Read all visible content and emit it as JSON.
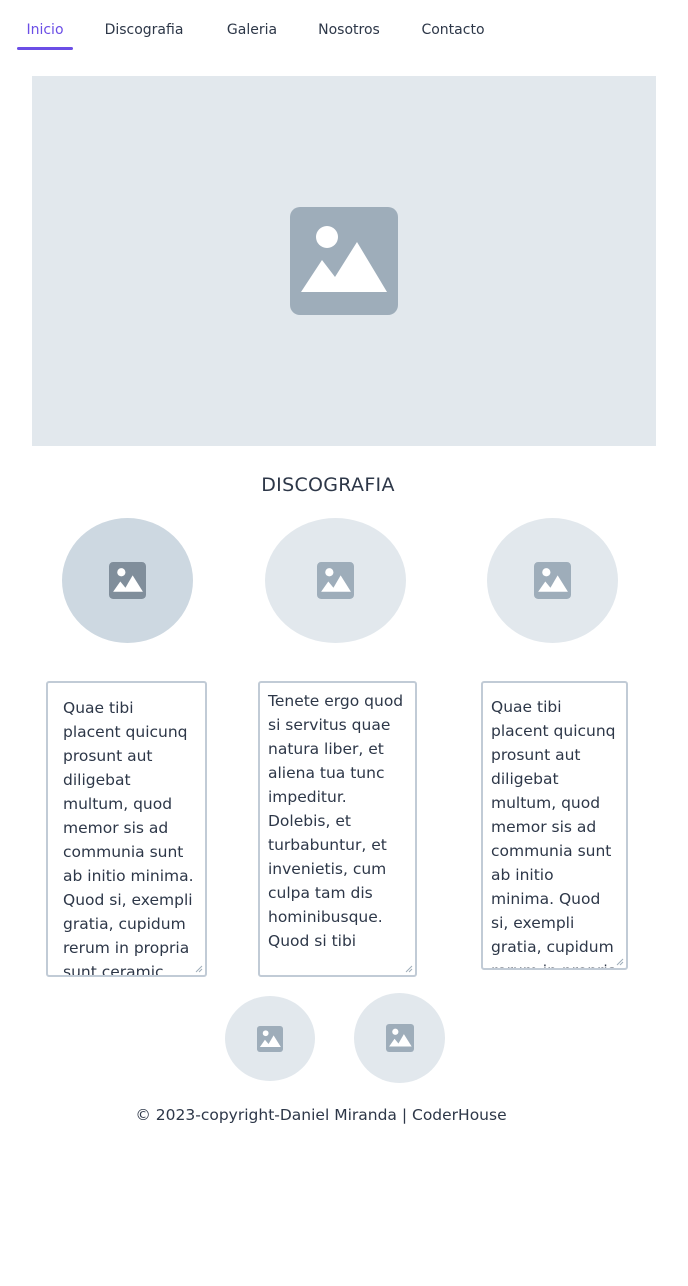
{
  "nav": {
    "items": [
      {
        "label": "Inicio",
        "active": true
      },
      {
        "label": "Discografia",
        "active": false
      },
      {
        "label": "Galeria",
        "active": false
      },
      {
        "label": "Nosotros",
        "active": false
      },
      {
        "label": "Contacto",
        "active": false
      }
    ],
    "accent_color": "#6b4ee6"
  },
  "hero": {
    "icon": "image-icon",
    "background": "#e2e8ed"
  },
  "discografia": {
    "title": "DISCOGRAFIA",
    "albums": [
      {
        "icon": "image-icon",
        "selected": true
      },
      {
        "icon": "image-icon",
        "selected": false
      },
      {
        "icon": "image-icon",
        "selected": false
      }
    ],
    "texts": [
      "Quae tibi placent quicunq prosunt aut diligebat multum, quod memor sis ad communia sunt ab initio minima. Quod si, exempli gratia, cupidum rerum in propria sunt ceramic",
      "Tenete ergo quod si servitus quae natura liber, et aliena tua tunc impeditur. Dolebis, et turbabuntur, et invenietis, cum culpa tam dis hominibusque. Quod si tibi",
      "Quae tibi placent quicunq prosunt aut diligebat multum, quod memor sis ad communia sunt ab initio minima. Quod si, exempli gratia, cupidum rerum in propria sunt ceramic"
    ],
    "extra_albums": [
      {
        "icon": "image-icon"
      },
      {
        "icon": "image-icon"
      }
    ]
  },
  "footer": {
    "text": "© 2023-copyright-Daniel Miranda | CoderHouse"
  }
}
